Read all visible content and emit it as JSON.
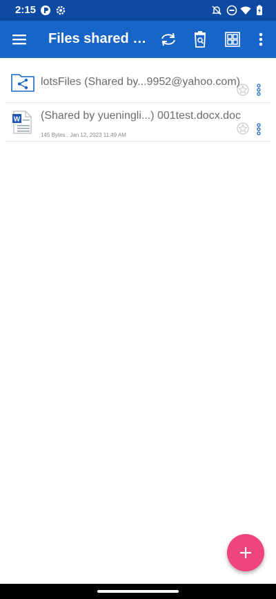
{
  "status_bar": {
    "time": "2:15",
    "icons": [
      "app-notification-icon",
      "settings-gear-icon",
      "do-not-disturb-off-icon",
      "dnd-icon",
      "wifi-icon",
      "battery-icon"
    ]
  },
  "app_bar": {
    "title": "Files shared w...",
    "actions": [
      "sync-icon",
      "trash-search-icon",
      "grid-view-icon",
      "overflow-menu-icon"
    ]
  },
  "files": [
    {
      "name": "lotsFiles (Shared by...9952@yahoo.com)",
      "meta": "",
      "icon": "shared-folder-icon"
    },
    {
      "name": "(Shared by yueningli...) 001test.docx.doc",
      "meta": "145 Bytes , Jan 12, 2023 11:49 AM",
      "icon": "word-document-icon"
    }
  ],
  "colors": {
    "status_bar": "#0e4aa2",
    "app_bar": "#1765c6",
    "fab": "#f0447f",
    "text": "#6b6b6b"
  }
}
